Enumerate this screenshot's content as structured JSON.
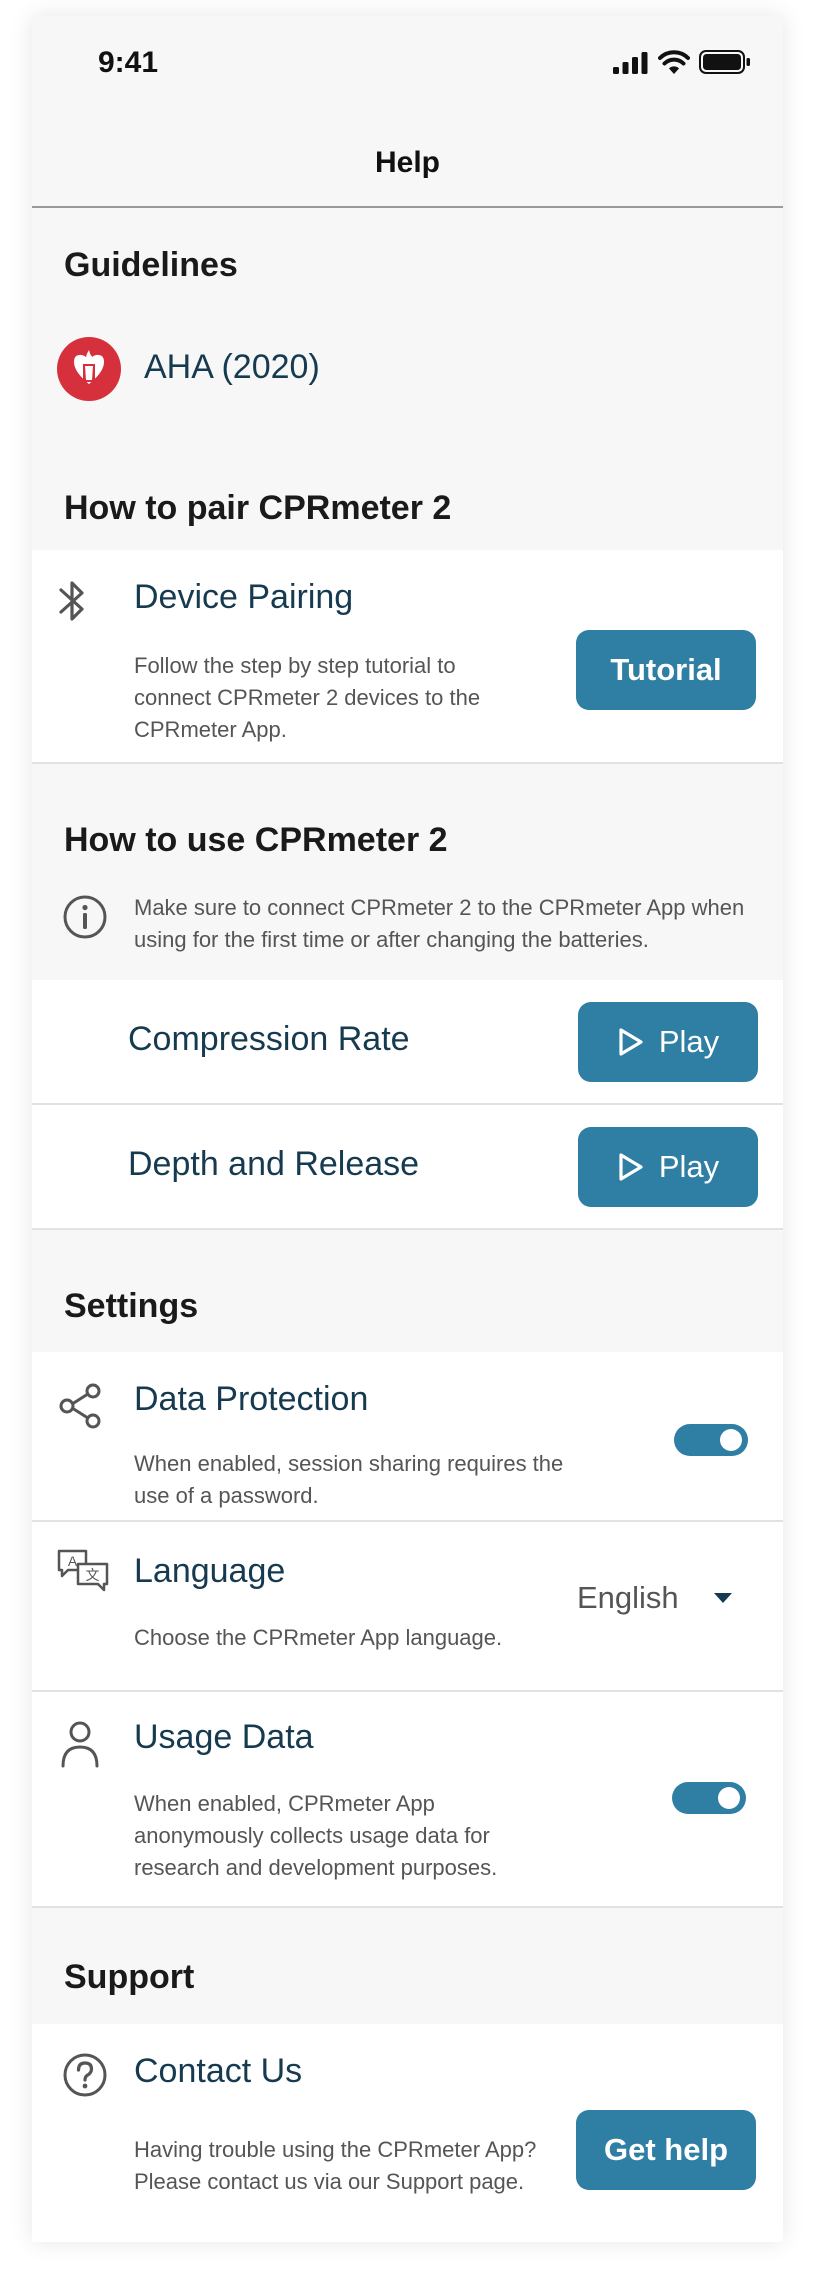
{
  "status_bar": {
    "time": "9:41"
  },
  "header": {
    "title": "Help"
  },
  "guidelines": {
    "section_title": "Guidelines",
    "item_label": "AHA (2020)"
  },
  "pairing": {
    "section_title": "How to pair CPRmeter 2",
    "row_title": "Device Pairing",
    "row_desc": "Follow the step by step tutorial to connect CPRmeter 2 devices to the CPRmeter App.",
    "button_label": "Tutorial"
  },
  "usage": {
    "section_title": "How to use CPRmeter 2",
    "info_text": "Make sure to connect CPRmeter 2 to the CPRmeter App when using for the first time or after changing the batteries.",
    "videos": [
      {
        "label": "Compression Rate",
        "button_label": "Play"
      },
      {
        "label": "Depth and Release",
        "button_label": "Play"
      }
    ]
  },
  "settings": {
    "section_title": "Settings",
    "data_protection": {
      "title": "Data Protection",
      "desc": "When enabled, session sharing requires the use of a password.",
      "enabled": true
    },
    "language": {
      "title": "Language",
      "desc": "Choose the CPRmeter App language.",
      "selected": "English"
    },
    "usage_data": {
      "title": "Usage Data",
      "desc": "When enabled, CPRmeter App anonymously collects usage data for research and development purposes.",
      "enabled": true
    }
  },
  "support": {
    "section_title": "Support",
    "row_title": "Contact Us",
    "row_desc": "Having trouble using the CPRmeter App? Please contact us via our Support page.",
    "button_label": "Get help"
  },
  "colors": {
    "accent": "#2f7ea3",
    "title_text": "#163a4f",
    "aha_red": "#d6303c",
    "background": "#f7f7f7"
  },
  "icons": {
    "aha": "aha-logo-icon",
    "bluetooth": "bluetooth-icon",
    "info": "info-icon",
    "play": "play-icon",
    "share": "share-icon",
    "language": "language-icon",
    "user": "user-icon",
    "help": "help-icon",
    "dropdown": "chevron-down-icon"
  }
}
